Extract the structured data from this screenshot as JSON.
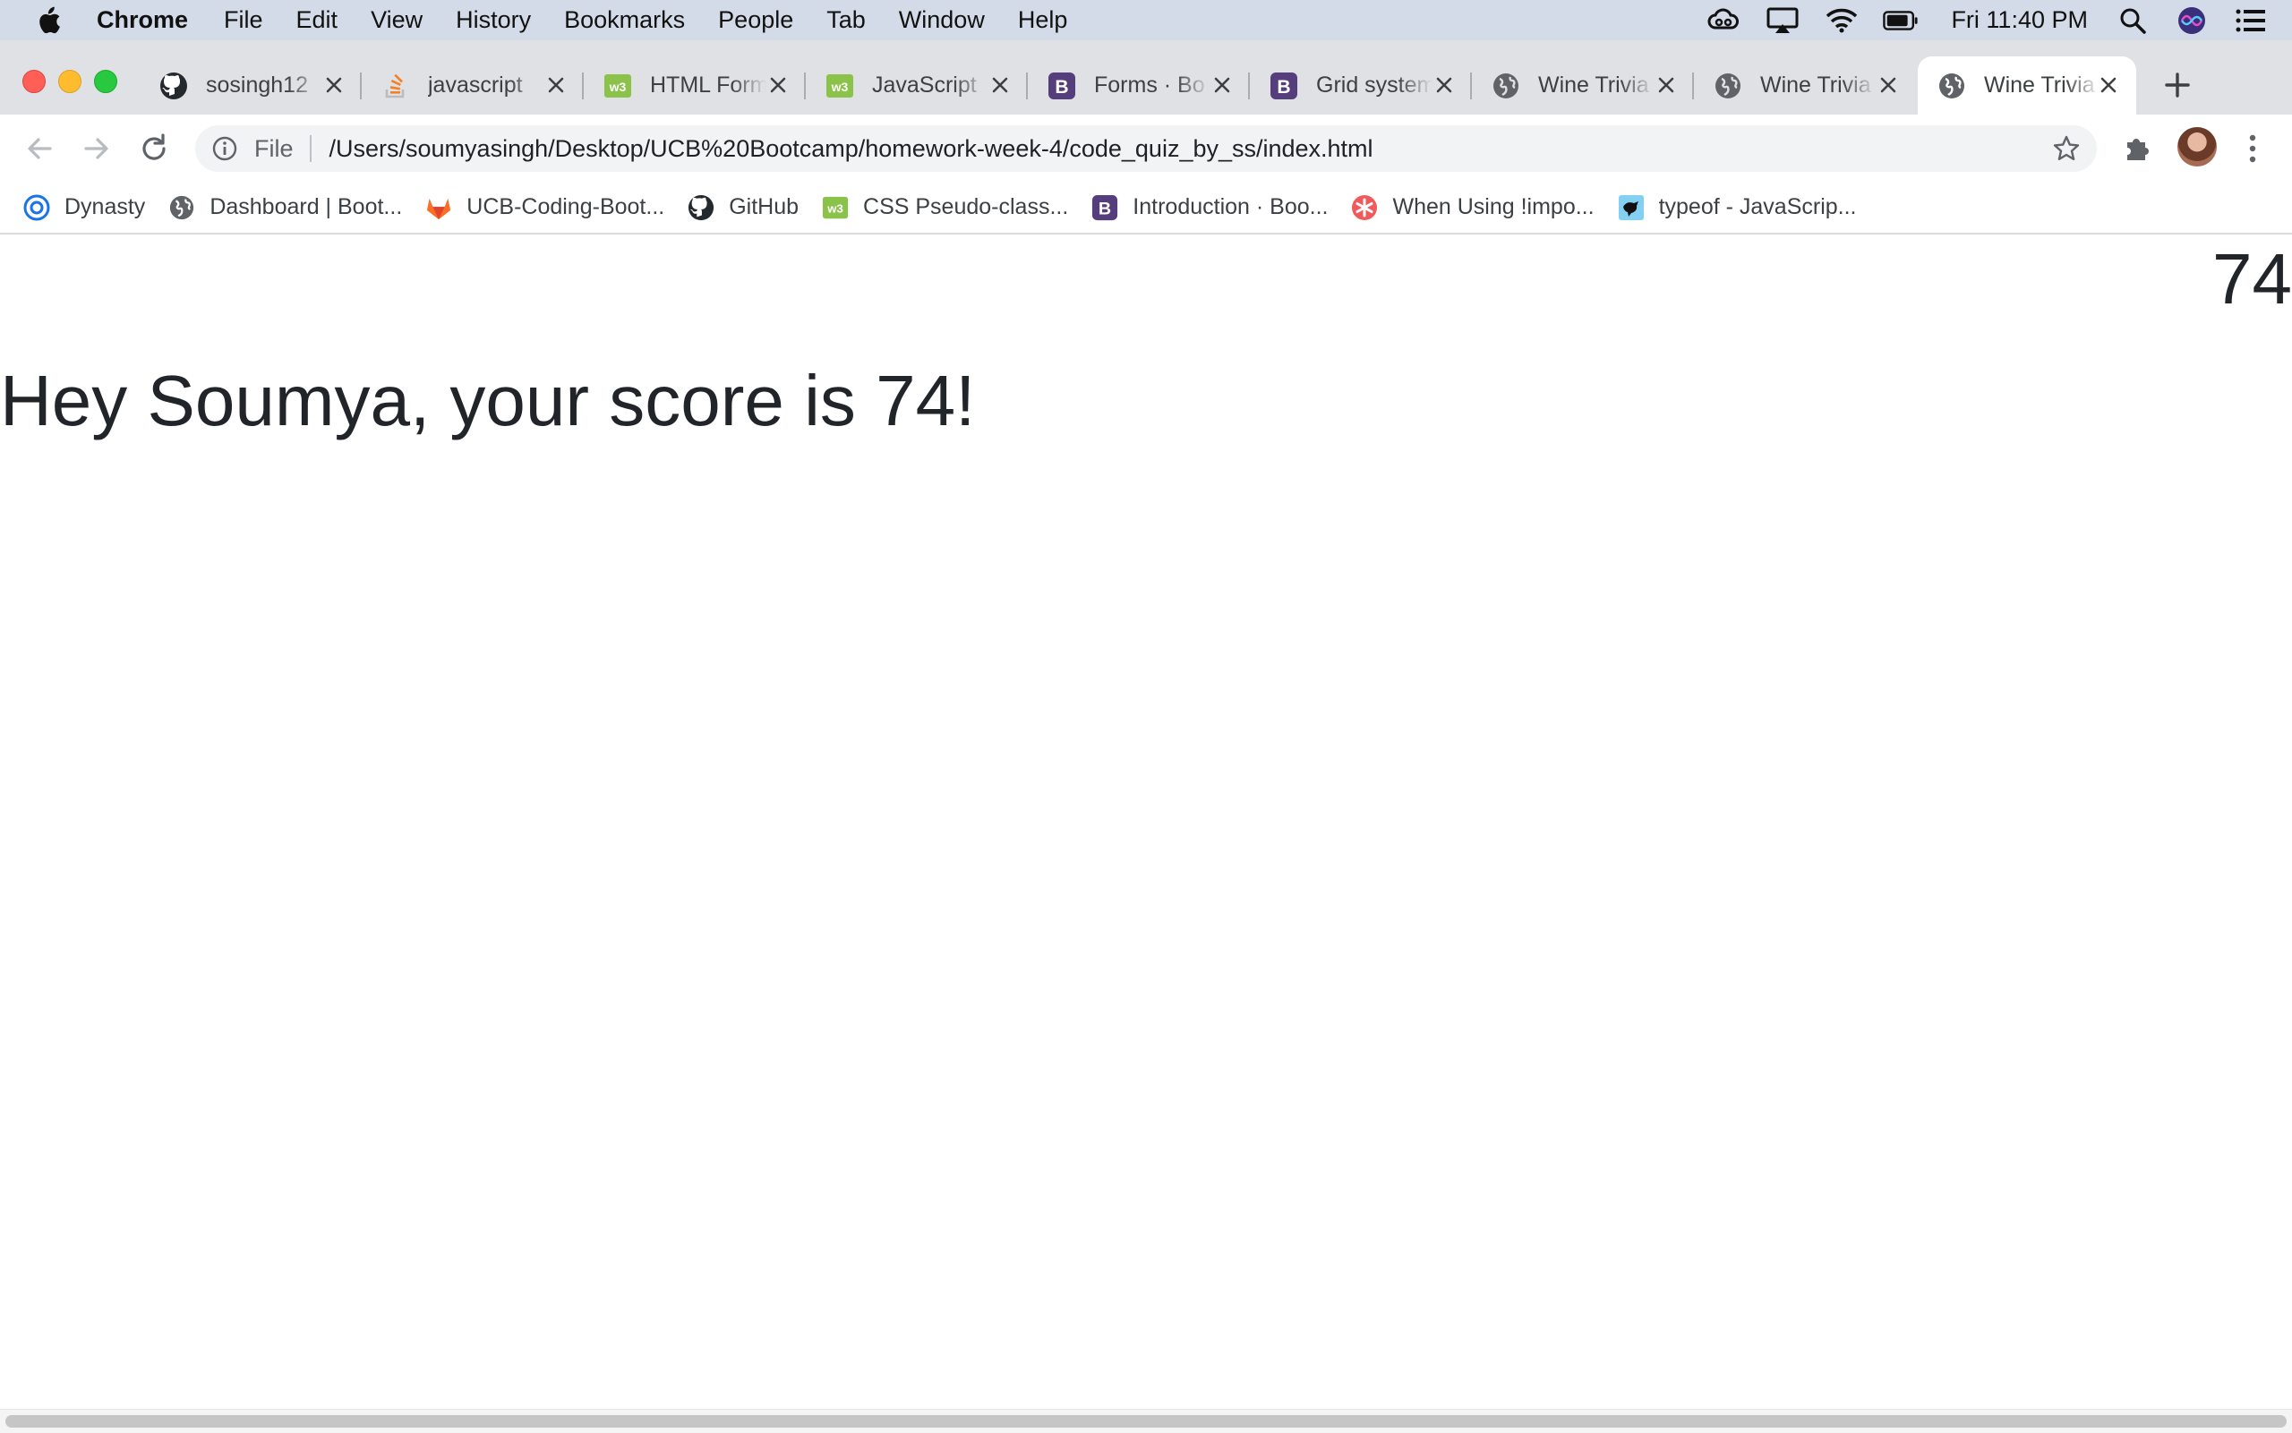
{
  "menubar": {
    "app_name": "Chrome",
    "items": [
      "File",
      "Edit",
      "View",
      "History",
      "Bookmarks",
      "People",
      "Tab",
      "Window",
      "Help"
    ],
    "clock": "Fri 11:40 PM"
  },
  "tabs": [
    {
      "title": "sosingh12",
      "icon": "github-icon",
      "active": false
    },
    {
      "title": "javascript",
      "icon": "stackoverflow-icon",
      "active": false
    },
    {
      "title": "HTML Form",
      "icon": "w3schools-icon",
      "active": false
    },
    {
      "title": "JavaScript",
      "icon": "w3schools-icon",
      "active": false
    },
    {
      "title": "Forms · Bo",
      "icon": "bootstrap-icon",
      "active": false
    },
    {
      "title": "Grid system",
      "icon": "bootstrap-icon",
      "active": false
    },
    {
      "title": "Wine Trivia",
      "icon": "globe-icon",
      "active": false
    },
    {
      "title": "Wine Trivia",
      "icon": "globe-icon",
      "active": false
    },
    {
      "title": "Wine Trivia",
      "icon": "globe-icon",
      "active": true
    }
  ],
  "omnibox": {
    "scheme_label": "File",
    "url": "/Users/soumyasingh/Desktop/UCB%20Bootcamp/homework-week-4/code_quiz_by_ss/index.html"
  },
  "bookmarks": [
    {
      "label": "Dynasty",
      "icon": "dynasty-icon"
    },
    {
      "label": "Dashboard | Boot...",
      "icon": "globe-icon"
    },
    {
      "label": "UCB-Coding-Boot...",
      "icon": "gitlab-icon"
    },
    {
      "label": "GitHub",
      "icon": "github-icon"
    },
    {
      "label": "CSS Pseudo-class...",
      "icon": "w3schools-icon"
    },
    {
      "label": "Introduction · Boo...",
      "icon": "bootstrap-icon"
    },
    {
      "label": "When Using !impo...",
      "icon": "asterisk-icon"
    },
    {
      "label": "typeof - JavaScrip...",
      "icon": "mdn-icon"
    }
  ],
  "page": {
    "score": "74",
    "message": "Hey Soumya, your score is 74!"
  },
  "colors": {
    "menubar": "#d4dbe8",
    "tabstrip": "#dfe1e5",
    "text": "#212529",
    "close": "#ff5f57",
    "minimize": "#febc2e",
    "zoom": "#28c840"
  }
}
